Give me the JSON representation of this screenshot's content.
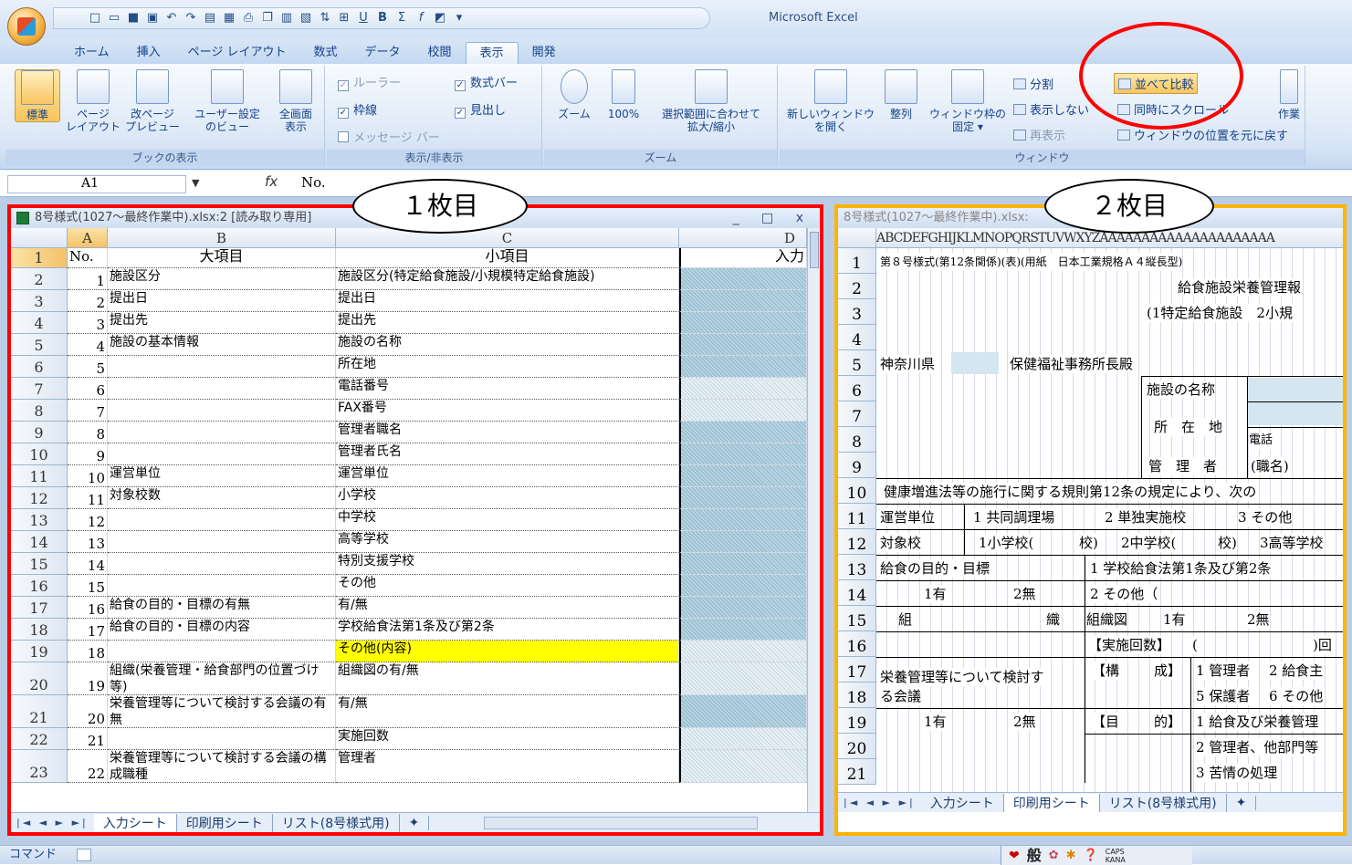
{
  "app": {
    "title": "Microsoft Excel"
  },
  "ribbon": {
    "tabs": [
      "ホーム",
      "挿入",
      "ページ レイアウト",
      "数式",
      "データ",
      "校閲",
      "表示",
      "開発"
    ],
    "active_tab": "表示",
    "groups": {
      "book_view": {
        "caption": "ブックの表示",
        "buttons": [
          "標準",
          "ページ\nレイアウト",
          "改ページ\nプレビュー",
          "ユーザー設定\nのビュー",
          "全画面\n表示"
        ]
      },
      "show_hide": {
        "caption": "表示/非表示",
        "ruler": "ルーラー",
        "gridlines": "枠線",
        "message_bar": "メッセージ バー",
        "formula_bar": "数式バー",
        "headings": "見出し"
      },
      "zoom": {
        "caption": "ズーム",
        "zoom": "ズーム",
        "zoom100": "100%",
        "zoom_sel": "選択範囲に合わせて\n拡大/縮小"
      },
      "window": {
        "caption": "ウィンドウ",
        "new_window": "新しいウィンドウ\nを開く",
        "arrange": "整列",
        "freeze": "ウィンドウ枠の\n固定 ▾",
        "split": "分割",
        "hide": "表示しない",
        "unhide": "再表示",
        "side_by_side": "並べて比較",
        "sync_scroll": "同時にスクロール",
        "reset_pos": "ウィンドウの位置を元に戻す",
        "workspace": "作業"
      }
    }
  },
  "formula_bar": {
    "name_box": "A1",
    "fx": "fx",
    "content": "No."
  },
  "callouts": {
    "left": "１枚目",
    "right": "２枚目"
  },
  "left_window": {
    "title": "8号様式(1027～最終作業中).xlsx:2 [読み取り専用]",
    "controls": "_ □ x",
    "columns": [
      "A",
      "B",
      "C",
      "D"
    ],
    "rows": [
      {
        "r": "1",
        "a": "No.",
        "b": "大項目",
        "c": "小項目",
        "d": "入力"
      },
      {
        "r": "2",
        "a": "1",
        "b": "施設区分",
        "c": "施設区分(特定給食施設/小規模特定給食施設)",
        "d": ""
      },
      {
        "r": "3",
        "a": "2",
        "b": "提出日",
        "c": "提出日",
        "d": ""
      },
      {
        "r": "4",
        "a": "3",
        "b": "提出先",
        "c": "提出先",
        "d": ""
      },
      {
        "r": "5",
        "a": "4",
        "b": "施設の基本情報",
        "c": "施設の名称",
        "d": ""
      },
      {
        "r": "6",
        "a": "5",
        "b": "",
        "c": "所在地",
        "d": ""
      },
      {
        "r": "7",
        "a": "6",
        "b": "",
        "c": "電話番号",
        "d": ""
      },
      {
        "r": "8",
        "a": "7",
        "b": "",
        "c": "FAX番号",
        "d": ""
      },
      {
        "r": "9",
        "a": "8",
        "b": "",
        "c": "管理者職名",
        "d": ""
      },
      {
        "r": "10",
        "a": "9",
        "b": "",
        "c": "管理者氏名",
        "d": ""
      },
      {
        "r": "11",
        "a": "10",
        "b": "運営単位",
        "c": "運営単位",
        "d": ""
      },
      {
        "r": "12",
        "a": "11",
        "b": "対象校数",
        "c": "小学校",
        "d": ""
      },
      {
        "r": "13",
        "a": "12",
        "b": "",
        "c": "中学校",
        "d": ""
      },
      {
        "r": "14",
        "a": "13",
        "b": "",
        "c": "高等学校",
        "d": ""
      },
      {
        "r": "15",
        "a": "14",
        "b": "",
        "c": "特別支援学校",
        "d": ""
      },
      {
        "r": "16",
        "a": "15",
        "b": "",
        "c": "その他",
        "d": ""
      },
      {
        "r": "17",
        "a": "16",
        "b": "給食の目的・目標の有無",
        "c": "有/無",
        "d": ""
      },
      {
        "r": "18",
        "a": "17",
        "b": "給食の目的・目標の内容",
        "c": "学校給食法第1条及び第2条",
        "d": ""
      },
      {
        "r": "19",
        "a": "18",
        "b": "",
        "c": "その他(内容)",
        "d": ""
      },
      {
        "r": "20",
        "a": "19",
        "b": "組織(栄養管理・給食部門の位置づけ等)",
        "c": "組織図の有/無",
        "d": ""
      },
      {
        "r": "21",
        "a": "20",
        "b": "栄養管理等について検討する会議の有無",
        "c": "有/無",
        "d": ""
      },
      {
        "r": "22",
        "a": "21",
        "b": "",
        "c": "実施回数",
        "d": ""
      },
      {
        "r": "23",
        "a": "22",
        "b": "栄養管理等について検討する会議の構成職種",
        "c": "管理者",
        "d": ""
      }
    ],
    "sheet_tabs": [
      "入力シート",
      "印刷用シート",
      "リスト(8号様式用)"
    ],
    "active_sheet": "入力シート"
  },
  "right_window": {
    "title": "8号様式(1027～最終作業中).xlsx:",
    "col_letters": "ABCDEFGHIJKLMNOPQRSTUVWXYZAAAAAAAAAAAAAAAAAAAAA",
    "row_numbers": [
      "1",
      "2",
      "3",
      "4",
      "5",
      "6",
      "7",
      "8",
      "9",
      "10",
      "11",
      "12",
      "13",
      "14",
      "15",
      "16",
      "17",
      "18",
      "19",
      "20",
      "21"
    ],
    "lines": {
      "r1": "第８号様式(第12条関係)(表)(用紙　日本工業規格Ａ４縦長型)",
      "r2": "給食施設栄養管理報",
      "r3": "(1特定給食施設　2小規",
      "r5a": "神奈川県",
      "r5b": "保健福祉事務所長殿",
      "r6": "施設の名称",
      "r7": "所　在　地",
      "r8": "電話",
      "r9a": "管　理　者",
      "r9b": "(職名)",
      "r10": "健康増進法等の施行に関する規則第12条の規定により、次の",
      "r11a": "運営単位",
      "r11b": "1 共同調理場",
      "r11c": "2 単独実施校",
      "r11d": "3 その他",
      "r12a": "対象校",
      "r12b": "1小学校(",
      "r12c": "校)",
      "r12d": "2中学校(",
      "r12e": "校)",
      "r12f": "3高等学校",
      "r13a": "給食の目的・目標",
      "r13b": "1 学校給食法第1条及び第2条",
      "r14a": "1有",
      "r14b": "2無",
      "r14c": "2 その他（",
      "r15a": "組",
      "r15b": "織",
      "r15c": "組織図",
      "r15d": "1有",
      "r15e": "2無",
      "r16a": "【実施回数】",
      "r16b": "(",
      "r16c": ")回",
      "r17a": "栄養管理等について検討す",
      "r17b": "【構",
      "r17c": "成】",
      "r17d": "1 管理者",
      "r17e": "2 給食主",
      "r18a": "る会議",
      "r18b": "5 保護者",
      "r18c": "6 その他",
      "r19a": "1有",
      "r19b": "2無",
      "r19c": "【目",
      "r19d": "的】",
      "r19e": "1 給食及び栄養管理",
      "r20": "2 管理者、他部門等",
      "r21": "3 苦情の処理"
    },
    "sheet_tabs": [
      "入力シート",
      "印刷用シート",
      "リスト(8号様式用)"
    ],
    "active_sheet": "印刷用シート"
  },
  "status_bar": {
    "mode": "コマンド",
    "ime": "般",
    "caps": "CAPS",
    "kana": "KANA"
  },
  "colors": {
    "left_frame": "#ff0000",
    "right_frame": "#ffb300",
    "highlight_circle": "#ff0000",
    "yellow_cell": "#ffff00"
  }
}
